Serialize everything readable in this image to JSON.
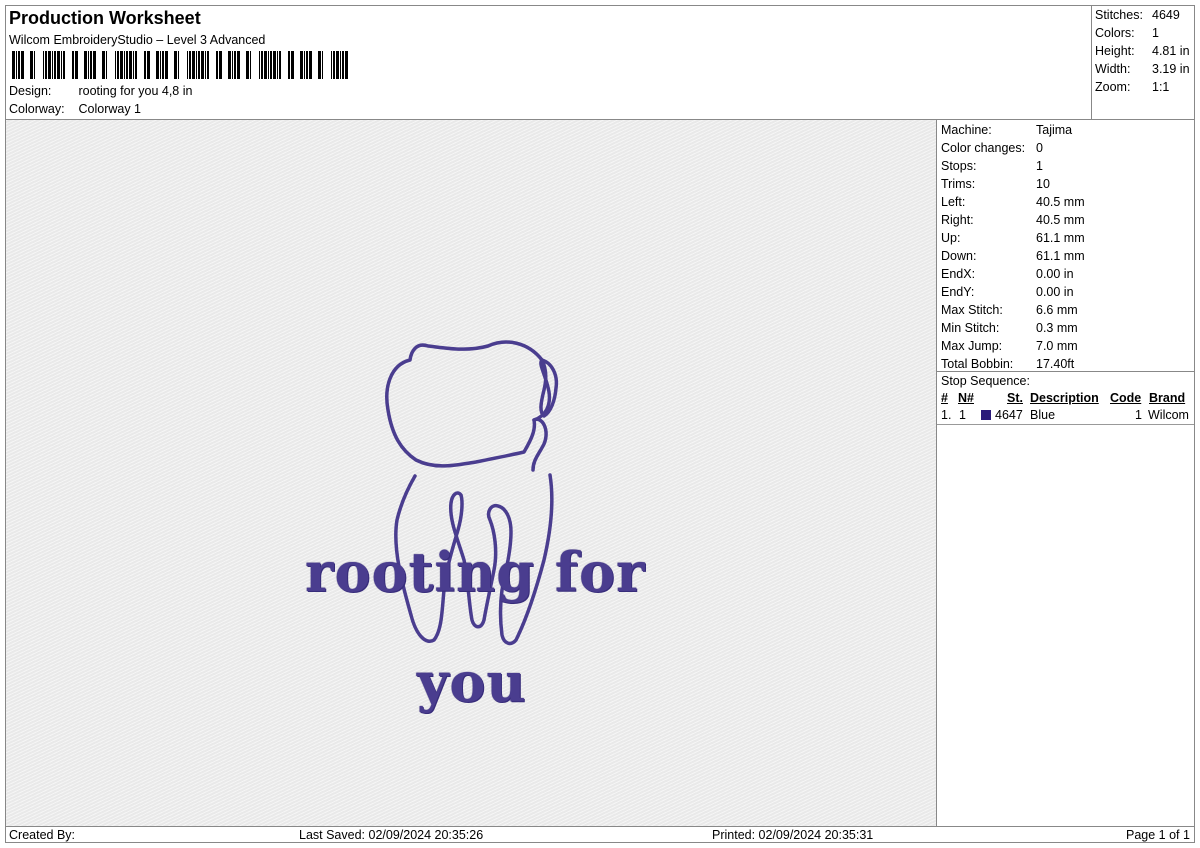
{
  "header": {
    "title": "Production Worksheet",
    "subtitle": "Wilcom EmbroideryStudio – Level 3 Advanced",
    "design_label": "Design:",
    "design_value": "rooting for you 4,8 in",
    "colorway_label": "Colorway:",
    "colorway_value": "Colorway 1"
  },
  "summary": [
    {
      "label": "Stitches:",
      "value": "4649"
    },
    {
      "label": "Colors:",
      "value": "1"
    },
    {
      "label": "Height:",
      "value": "4.81 in"
    },
    {
      "label": "Width:",
      "value": "3.19 in"
    },
    {
      "label": "Zoom:",
      "value": "1:1"
    }
  ],
  "specs": [
    {
      "label": "Machine:",
      "value": "Tajima"
    },
    {
      "label": "Color changes:",
      "value": "0"
    },
    {
      "label": "Stops:",
      "value": "1"
    },
    {
      "label": "Trims:",
      "value": "10"
    },
    {
      "label": "Left:",
      "value": "40.5 mm"
    },
    {
      "label": "Right:",
      "value": "40.5 mm"
    },
    {
      "label": "Up:",
      "value": "61.1 mm"
    },
    {
      "label": "Down:",
      "value": "61.1 mm"
    },
    {
      "label": "EndX:",
      "value": "0.00 in"
    },
    {
      "label": "EndY:",
      "value": "0.00 in"
    },
    {
      "label": "Max Stitch:",
      "value": "6.6 mm"
    },
    {
      "label": "Min Stitch:",
      "value": "0.3 mm"
    },
    {
      "label": "Max Jump:",
      "value": "7.0 mm"
    },
    {
      "label": "Total Bobbin:",
      "value": "17.40ft"
    }
  ],
  "stop_sequence": {
    "title": "Stop Sequence:",
    "columns": [
      "#",
      "N#",
      "St.",
      "Description",
      "Code",
      "Brand"
    ],
    "rows": [
      {
        "num": "1.",
        "n": "1",
        "st": "4647",
        "description": "Blue",
        "code": "1",
        "brand": "Wilcom",
        "color": "#2a1a7a"
      }
    ]
  },
  "design_art": {
    "line1": "rooting for",
    "line2": "you",
    "thread_color": "#4a3d8f",
    "icon": "tooth-icon"
  },
  "footer": {
    "created_by": "Created By:",
    "last_saved": "Last Saved: 02/09/2024 20:35:26",
    "printed": "Printed: 02/09/2024 20:35:31",
    "page": "Page 1 of 1"
  }
}
